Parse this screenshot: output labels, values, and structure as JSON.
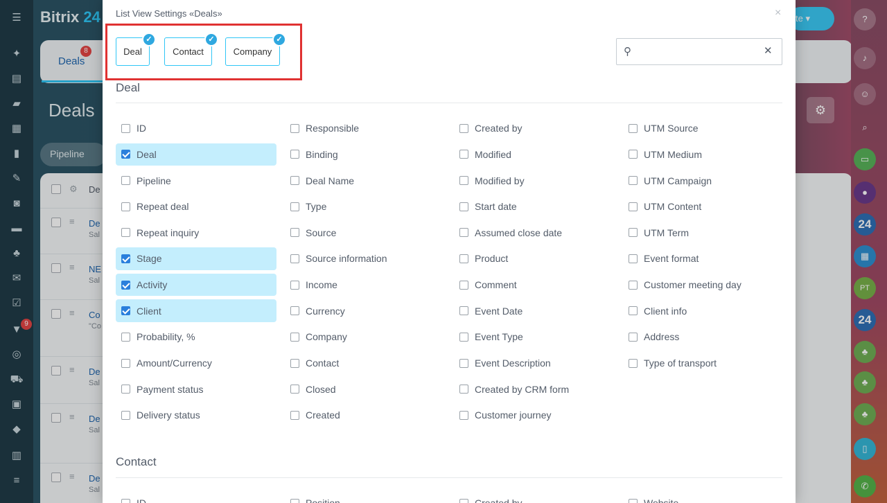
{
  "background": {
    "app_name": "Bitrix",
    "app_name_suffix": "24",
    "tab_label": "Deals",
    "tab_badge": "8",
    "heading": "Deals",
    "pipeline_filter": "Pipeline",
    "left_rail_badge": "9",
    "list_rows": [
      {
        "title": "De",
        "sub": "Sal"
      },
      {
        "title": "NE",
        "sub": "Sal"
      },
      {
        "title": "Co",
        "sub": "\"Co"
      },
      {
        "title": "De",
        "sub": "Sal"
      },
      {
        "title": "De",
        "sub": "Sal"
      },
      {
        "title": "De",
        "sub": "Sal"
      }
    ],
    "column_header_fragment": "De",
    "create_button_fragment": "te",
    "right_rail_avatars": [
      "24",
      "PT",
      "24"
    ]
  },
  "modal": {
    "title": "List View Settings «Deals»",
    "close_icon": "×",
    "entity_tabs": [
      {
        "label": "Deal",
        "selected": true
      },
      {
        "label": "Contact",
        "selected": true
      },
      {
        "label": "Company",
        "selected": true
      }
    ],
    "search": {
      "value": "",
      "placeholder": ""
    },
    "sections": [
      {
        "title": "Deal",
        "columns": [
          [
            {
              "label": "ID",
              "checked": false
            },
            {
              "label": "Deal",
              "checked": true
            },
            {
              "label": "Pipeline",
              "checked": false
            },
            {
              "label": "Repeat deal",
              "checked": false
            },
            {
              "label": "Repeat inquiry",
              "checked": false
            },
            {
              "label": "Stage",
              "checked": true
            },
            {
              "label": "Activity",
              "checked": true
            },
            {
              "label": "Client",
              "checked": true
            },
            {
              "label": "Probability, %",
              "checked": false
            },
            {
              "label": "Amount/Currency",
              "checked": false
            },
            {
              "label": "Payment status",
              "checked": false
            },
            {
              "label": "Delivery status",
              "checked": false
            }
          ],
          [
            {
              "label": "Responsible",
              "checked": false
            },
            {
              "label": "Binding",
              "checked": false
            },
            {
              "label": "Deal Name",
              "checked": false
            },
            {
              "label": "Type",
              "checked": false
            },
            {
              "label": "Source",
              "checked": false
            },
            {
              "label": "Source information",
              "checked": false
            },
            {
              "label": "Income",
              "checked": false
            },
            {
              "label": "Currency",
              "checked": false
            },
            {
              "label": "Company",
              "checked": false
            },
            {
              "label": "Contact",
              "checked": false
            },
            {
              "label": "Closed",
              "checked": false
            },
            {
              "label": "Created",
              "checked": false
            }
          ],
          [
            {
              "label": "Created by",
              "checked": false
            },
            {
              "label": "Modified",
              "checked": false
            },
            {
              "label": "Modified by",
              "checked": false
            },
            {
              "label": "Start date",
              "checked": false
            },
            {
              "label": "Assumed close date",
              "checked": false
            },
            {
              "label": "Product",
              "checked": false
            },
            {
              "label": "Comment",
              "checked": false
            },
            {
              "label": "Event Date",
              "checked": false
            },
            {
              "label": "Event Type",
              "checked": false
            },
            {
              "label": "Event Description",
              "checked": false
            },
            {
              "label": "Created by CRM form",
              "checked": false
            },
            {
              "label": "Customer journey",
              "checked": false
            }
          ],
          [
            {
              "label": "UTM Source",
              "checked": false
            },
            {
              "label": "UTM Medium",
              "checked": false
            },
            {
              "label": "UTM Campaign",
              "checked": false
            },
            {
              "label": "UTM Content",
              "checked": false
            },
            {
              "label": "UTM Term",
              "checked": false
            },
            {
              "label": "Event format",
              "checked": false
            },
            {
              "label": "Customer meeting day",
              "checked": false
            },
            {
              "label": "Client info",
              "checked": false
            },
            {
              "label": "Address",
              "checked": false
            },
            {
              "label": "Type of transport",
              "checked": false
            }
          ]
        ]
      },
      {
        "title": "Contact",
        "partial_first_row": [
          "ID",
          "Position",
          "Created by",
          "Website"
        ]
      }
    ]
  },
  "colors": {
    "accent": "#2fc6f6",
    "checked_row": "#c4eefd",
    "checkbox_checked": "#2a7fdc",
    "highlight_frame": "#e03232"
  }
}
